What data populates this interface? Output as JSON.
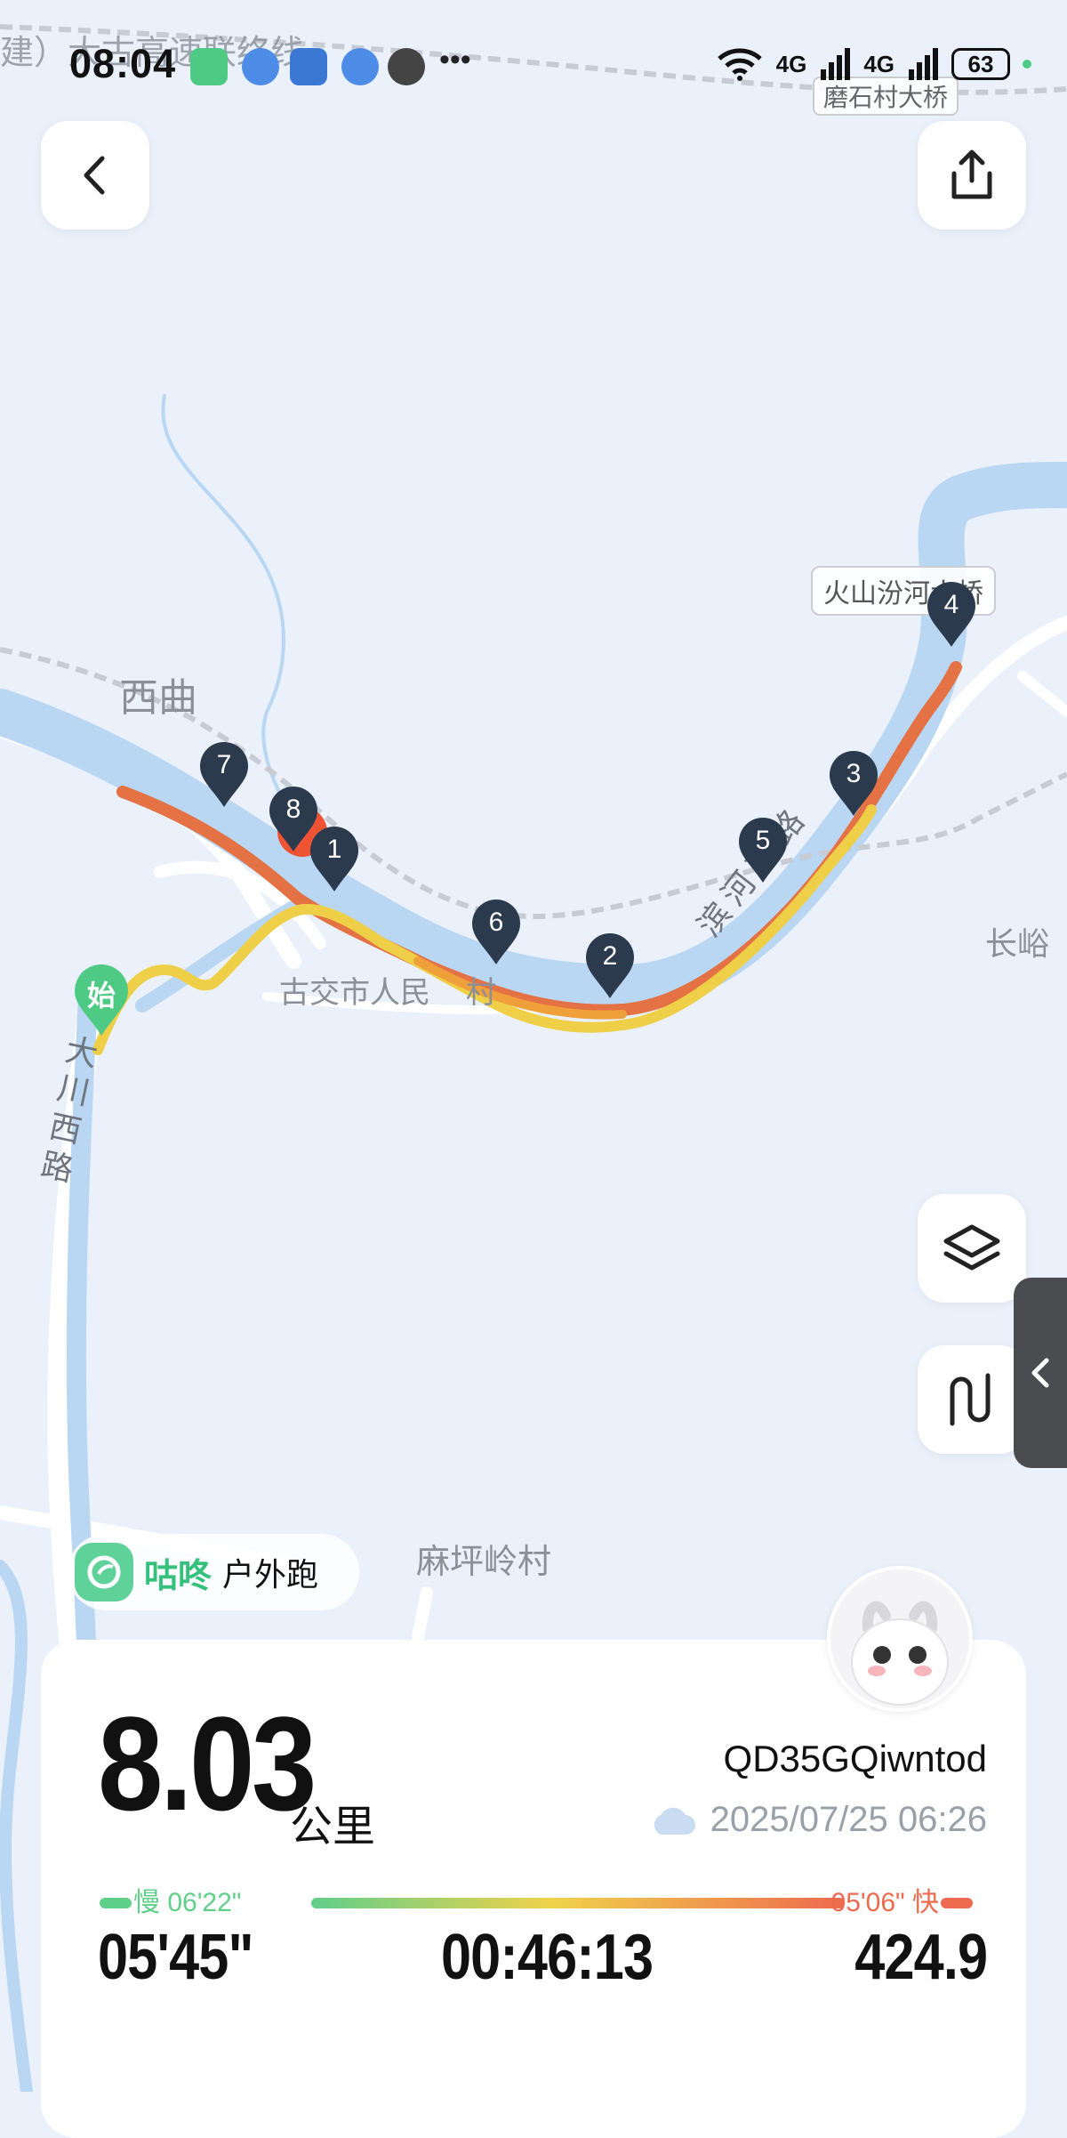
{
  "status_bar": {
    "time": "08:04",
    "network_1": "4G",
    "network_2": "4G",
    "battery": "63"
  },
  "map": {
    "labels": {
      "top_left_road": "建）大古高速联络线",
      "bridge_top": "磨石村大桥",
      "bridge_right": "火山汾河大桥",
      "village_xiqu": "西曲",
      "village_gujiao": "古交市人民",
      "village_gujiao_suffix": "村",
      "road_binhe": "滨河南路",
      "road_dachuan": "大川西路",
      "village_changyu": "长峪",
      "village_mapingling": "麻坪岭村"
    },
    "start_marker": "始",
    "km_markers": [
      "1",
      "2",
      "3",
      "4",
      "5",
      "6",
      "7",
      "8"
    ]
  },
  "app_pill": {
    "brand": "咕咚",
    "activity": "户外跑"
  },
  "summary": {
    "distance": "8.03",
    "distance_unit": "公里",
    "username": "QD35GQiwntod",
    "datetime": "2025/07/25 06:26",
    "pace_slow_label": "慢 06'22\"",
    "pace_fast_label": "05'06\" 快",
    "avg_pace": "05'45\"",
    "duration": "00:46:13",
    "third_stat": "424.9"
  },
  "colors": {
    "accent_green": "#35c07c",
    "pace_slow": "#5fcf8a",
    "pace_mid": "#f0d24a",
    "pace_fast": "#ee6a4e",
    "marker": "#2c3a4d",
    "river": "#b9d6f2"
  },
  "icons": {
    "back": "chevron-left-icon",
    "share": "share-icon",
    "layers": "layers-icon",
    "track": "track-icon",
    "collapse": "chevron-left-icon",
    "weather": "cloud-icon"
  }
}
